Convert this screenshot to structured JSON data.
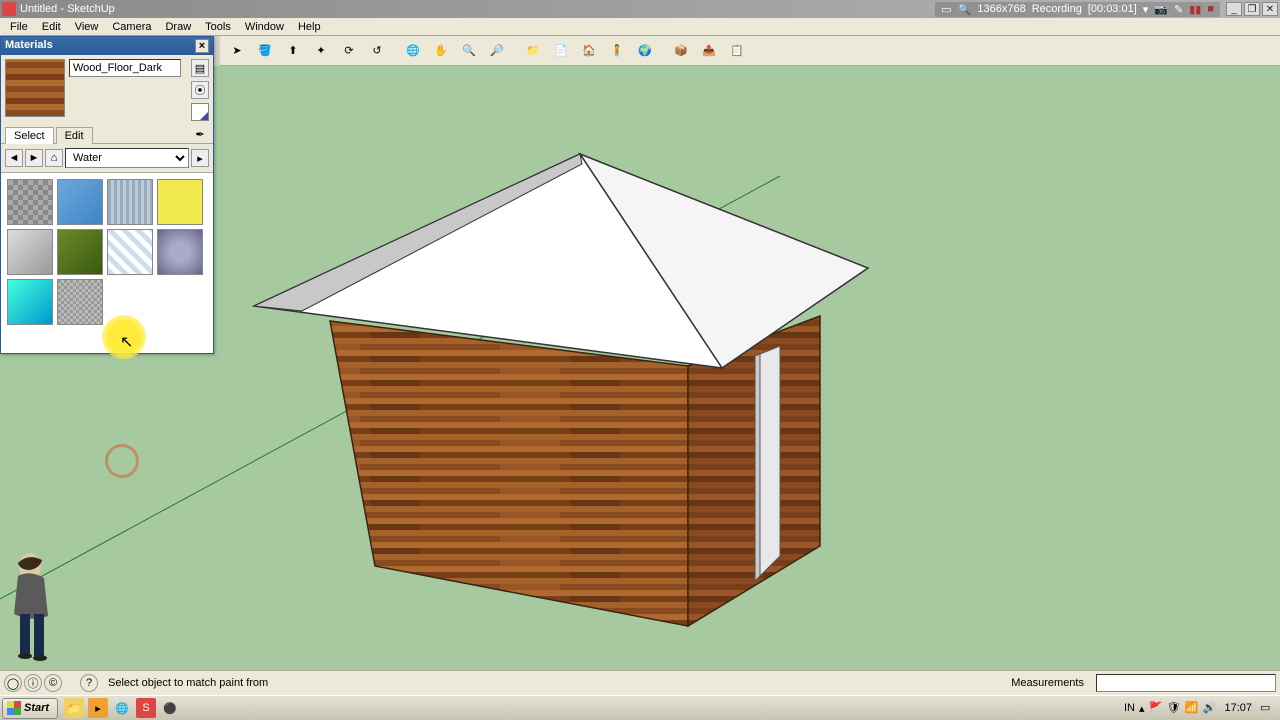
{
  "title": "Untitled - SketchUp",
  "recorder": {
    "resolution": "1366x768",
    "status": "Recording",
    "time": "[00:03:01]"
  },
  "menu": [
    "File",
    "Edit",
    "View",
    "Camera",
    "Draw",
    "Tools",
    "Window",
    "Help"
  ],
  "materials": {
    "panel_title": "Materials",
    "current_name": "Wood_Floor_Dark",
    "tabs": {
      "select": "Select",
      "edit": "Edit"
    },
    "library": "Water"
  },
  "status": {
    "hint": "Select object to match paint from",
    "measurements_label": "Measurements"
  },
  "taskbar": {
    "start": "Start",
    "lang": "IN",
    "time": "17:07"
  },
  "swatches": [
    "water-rough-gray",
    "water-deep-blue",
    "water-stripes",
    "water-yellow",
    "water-flat-gray",
    "water-green",
    "water-pool-grid",
    "water-cloudy",
    "water-cyan",
    "water-pebbles"
  ]
}
